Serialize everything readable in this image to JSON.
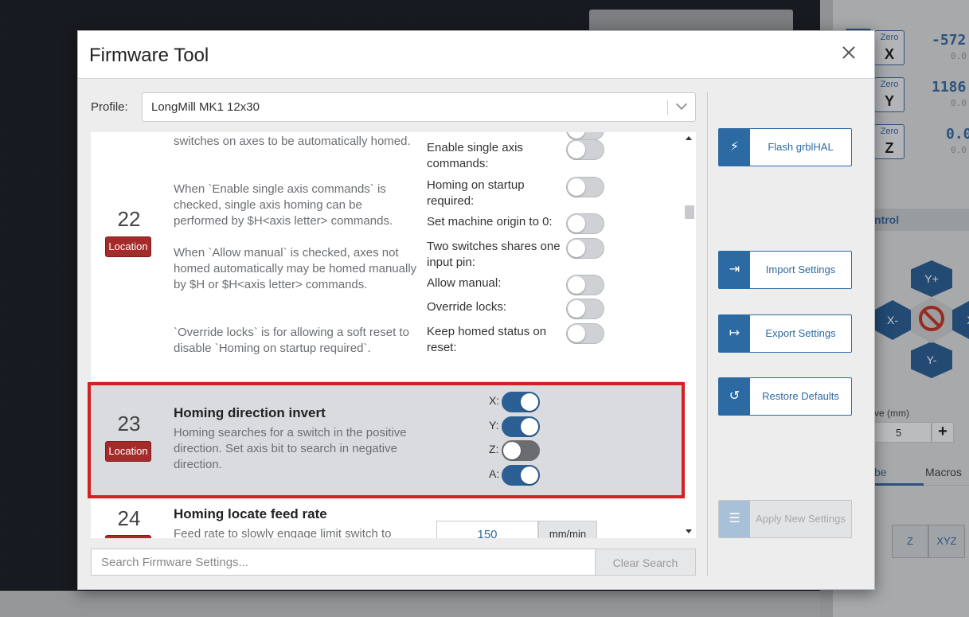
{
  "background": {
    "axes": [
      {
        "zero_label": "Zero",
        "axis": "X",
        "value": "-572",
        "sub": "0.0"
      },
      {
        "zero_label": "Zero",
        "axis": "Y",
        "value": "1186",
        "sub": "0.0"
      },
      {
        "zero_label": "Zero",
        "axis": "Z",
        "value": "0.0",
        "sub": "0.0"
      }
    ],
    "jog_header": "ntrol",
    "jog": {
      "y_plus": "Y+",
      "y_minus": "Y-",
      "x_minus": "X-",
      "x_plus": "X"
    },
    "move_label": "ve (mm)",
    "move_value": "5",
    "move_plus": "+",
    "tab_active": "be",
    "tab_macros": "Macros",
    "axis_buttons": [
      "Z",
      "XYZ"
    ]
  },
  "modal": {
    "title": "Firmware Tool",
    "profile_label": "Profile:",
    "profile_value": "LongMill MK1 12x30",
    "setting_22": {
      "number": "22",
      "location": "Location",
      "desc_1": "switches on axes to be automatically homed.",
      "desc_2": "When `Enable single axis commands` is checked, single axis homing can be performed by $H<axis letter> commands.",
      "desc_3": "When `Allow manual` is checked, axes not homed automatically may be homed manually by $H or $H<axis letter> commands.",
      "desc_4": "`Override locks` is for allowing a soft reset to disable `Homing on startup required`.",
      "options": [
        {
          "label": "Enable single axis commands:",
          "on": false
        },
        {
          "label": "Homing on startup required:",
          "on": false
        },
        {
          "label": "Set machine origin to 0:",
          "on": false
        },
        {
          "label": "Two switches shares one input pin:",
          "on": false
        },
        {
          "label": "Allow manual:",
          "on": false
        },
        {
          "label": "Override locks:",
          "on": false
        },
        {
          "label": "Keep homed status on reset:",
          "on": false
        }
      ]
    },
    "setting_23": {
      "number": "23",
      "location": "Location",
      "title": "Homing direction invert",
      "desc": "Homing searches for a switch in the positive direction. Set axis bit to search in negative direction.",
      "axes": [
        {
          "label": "X:",
          "on": true
        },
        {
          "label": "Y:",
          "on": true
        },
        {
          "label": "Z:",
          "on": false
        },
        {
          "label": "A:",
          "on": true
        }
      ]
    },
    "setting_24": {
      "number": "24",
      "title": "Homing locate feed rate",
      "desc": "Feed rate to slowly engage limit switch to",
      "value": "150",
      "unit": "mm/min"
    },
    "search_placeholder": "Search Firmware Settings...",
    "clear_search": "Clear Search",
    "buttons": {
      "flash": "Flash grblHAL",
      "import": "Import Settings",
      "export": "Export Settings",
      "restore": "Restore Defaults",
      "apply": "Apply New Settings"
    },
    "colors": {
      "accent": "#2c6aa3",
      "badge": "#a52a2a",
      "highlight_outline": "#d32020"
    }
  }
}
